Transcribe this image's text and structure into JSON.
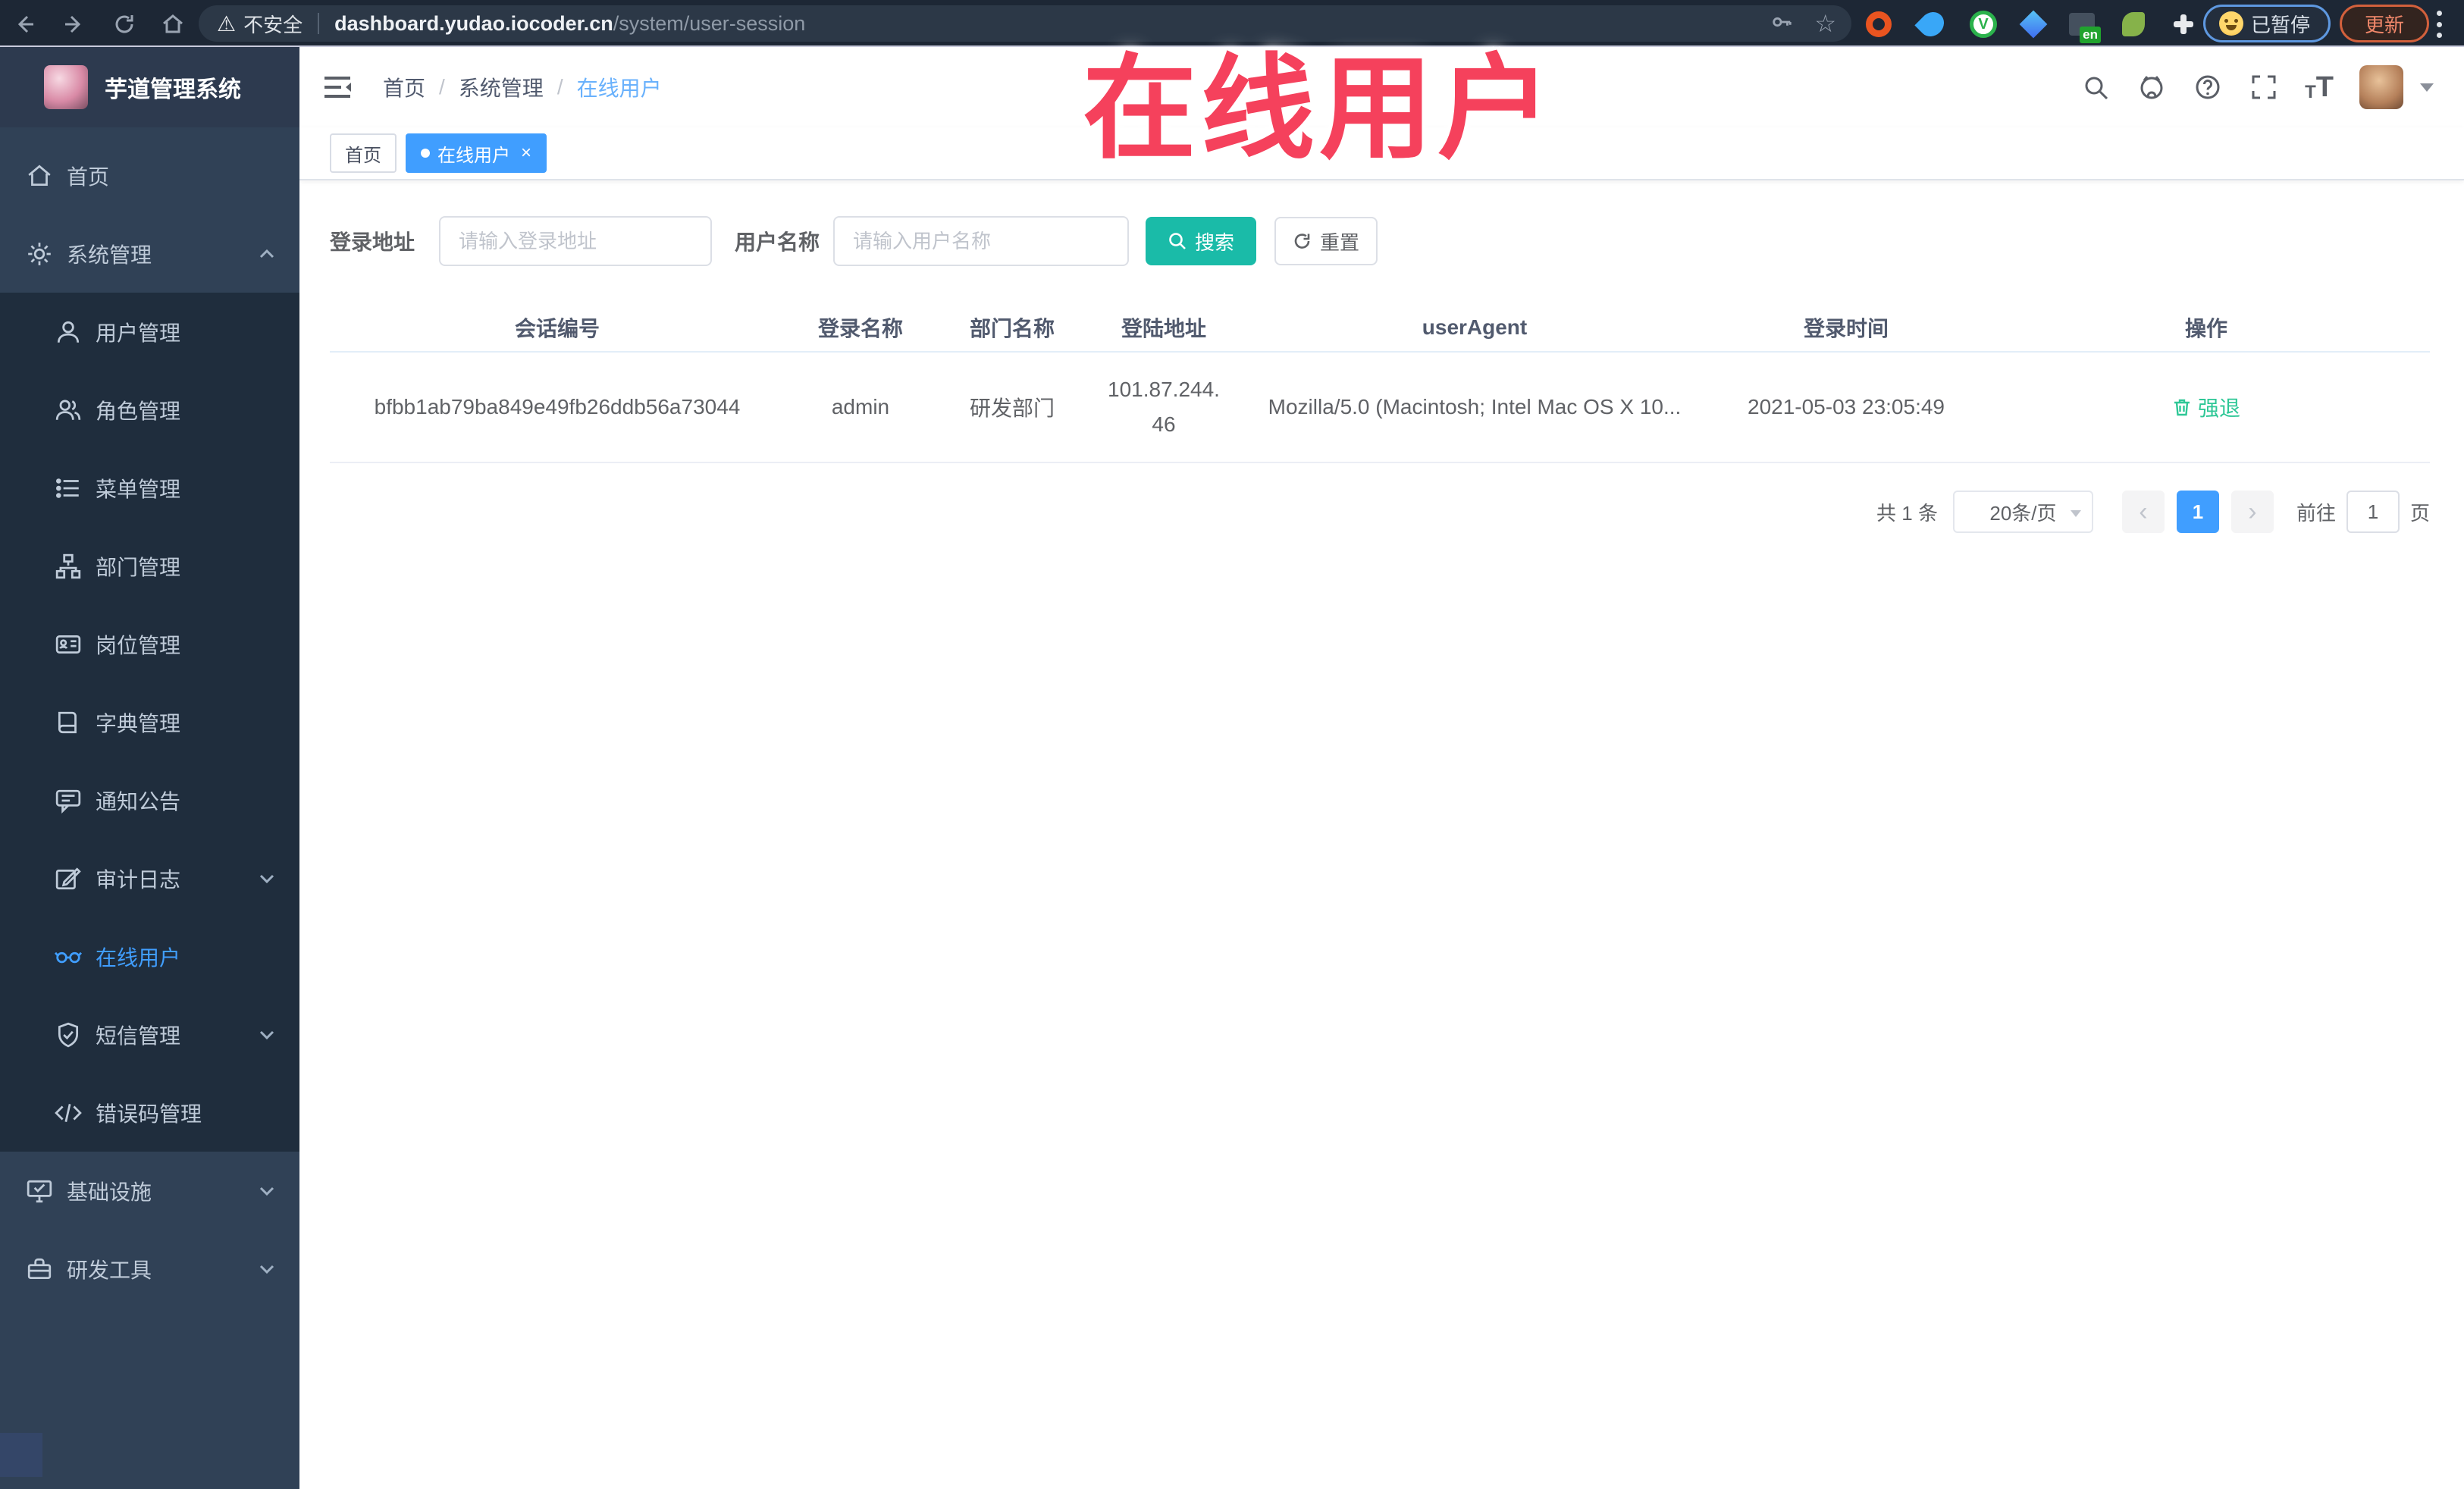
{
  "browser": {
    "security_label": "不安全",
    "url_host": "dashboard.yudao.iocoder.cn",
    "url_path": "/system/user-session",
    "extension_en_label": "en",
    "paused_label": "已暂停",
    "update_label": "更新"
  },
  "watermark": {
    "text": "在线用户",
    "color": "#f5415c"
  },
  "header": {
    "logo_title": "芋道管理系统",
    "breadcrumb": [
      {
        "label": "首页"
      },
      {
        "label": "系统管理"
      },
      {
        "label": "在线用户"
      }
    ]
  },
  "tabs": [
    {
      "label": "首页",
      "active": false
    },
    {
      "label": "在线用户",
      "active": true,
      "close": "×"
    }
  ],
  "sidebar": {
    "items": [
      {
        "label": "首页"
      },
      {
        "label": "系统管理"
      },
      {
        "label": "用户管理"
      },
      {
        "label": "角色管理"
      },
      {
        "label": "菜单管理"
      },
      {
        "label": "部门管理"
      },
      {
        "label": "岗位管理"
      },
      {
        "label": "字典管理"
      },
      {
        "label": "通知公告"
      },
      {
        "label": "审计日志"
      },
      {
        "label": "在线用户"
      },
      {
        "label": "短信管理"
      },
      {
        "label": "错误码管理"
      },
      {
        "label": "基础设施"
      },
      {
        "label": "研发工具"
      }
    ]
  },
  "filters": {
    "address_label": "登录地址",
    "address_placeholder": "请输入登录地址",
    "name_label": "用户名称",
    "name_placeholder": "请输入用户名称",
    "search_label": "搜索",
    "reset_label": "重置"
  },
  "table": {
    "columns": [
      "会话编号",
      "登录名称",
      "部门名称",
      "登陆地址",
      "userAgent",
      "登录时间",
      "操作"
    ],
    "rows": [
      {
        "session_id": "bfbb1ab79ba849e49fb26ddb56a73044",
        "username": "admin",
        "dept_name": "研发部门",
        "login_ip": "101.87.244.46",
        "user_agent": "Mozilla/5.0 (Macintosh; Intel Mac OS X 10...",
        "login_time": "2021-05-03 23:05:49",
        "action_label": "强退"
      }
    ]
  },
  "pagination": {
    "total": "共 1 条",
    "page_size": "20条/页",
    "prev": "‹",
    "page": "1",
    "next": "›",
    "goto": "前往",
    "goto_value": "1",
    "unit": "页"
  },
  "colors": {
    "accent_blue": "#409eff",
    "accent_teal": "#1abba8",
    "action_green": "#2ec796",
    "sidebar_bg": "#304156",
    "submenu_bg": "#1f2d3d",
    "watermark_red": "#f5415c"
  }
}
